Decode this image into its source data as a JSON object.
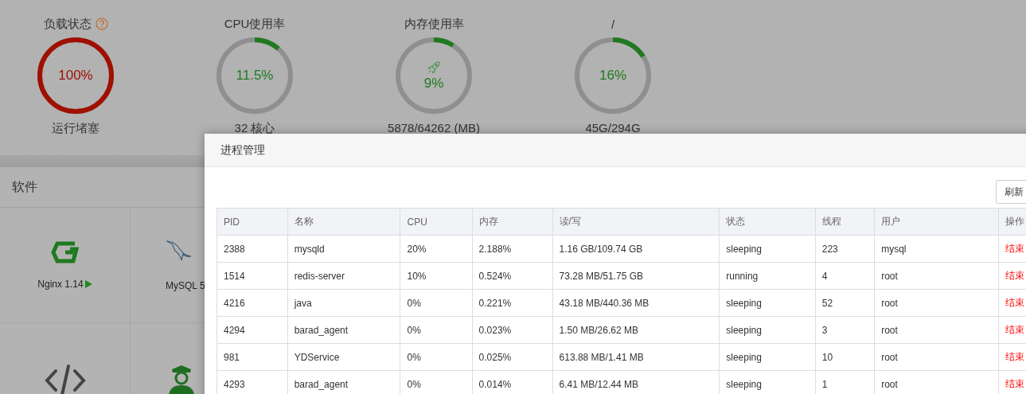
{
  "gauges": [
    {
      "title": "负载状态",
      "help": true,
      "value": "100%",
      "level": 1,
      "color": "#a01000",
      "caption": "运行堵塞"
    },
    {
      "title": "CPU使用率",
      "help": false,
      "value": "11.5%",
      "level": 0.115,
      "color": "#1f7a1f",
      "caption": "32 核心"
    },
    {
      "title": "内存使用率",
      "help": false,
      "value": "9%",
      "level": 0.09,
      "color": "#1f7a1f",
      "caption": "5878/64262 (MB)"
    },
    {
      "title": "/",
      "help": false,
      "value": "16%",
      "level": 0.16,
      "color": "#1f7a1f",
      "caption": "45G/294G"
    }
  ],
  "software": {
    "title": "软件",
    "items": [
      {
        "kind": "nginx",
        "name": "Nginx 1.14",
        "running": true
      },
      {
        "kind": "mysql",
        "name": "MySQL 5"
      },
      {
        "kind": "code"
      },
      {
        "kind": "person"
      }
    ]
  },
  "dialog": {
    "title": "进程管理",
    "refresh_button": "刷新",
    "table": {
      "columns": [
        "PID",
        "名称",
        "CPU",
        "内存",
        "读/写",
        "状态",
        "线程",
        "用户",
        "操作"
      ],
      "rows": [
        [
          "2388",
          "mysqld",
          "20%",
          "2.188%",
          "1.16 GB/109.74 GB",
          "sleeping",
          "223",
          "mysql",
          "结束"
        ],
        [
          "1514",
          "redis-server",
          "10%",
          "0.524%",
          "73.28 MB/51.75 GB",
          "running",
          "4",
          "root",
          "结束"
        ],
        [
          "4216",
          "java",
          "0%",
          "0.221%",
          "43.18 MB/440.36 MB",
          "sleeping",
          "52",
          "root",
          "结束"
        ],
        [
          "4294",
          "barad_agent",
          "0%",
          "0.023%",
          "1.50 MB/26.62 MB",
          "sleeping",
          "3",
          "root",
          "结束"
        ],
        [
          "981",
          "YDService",
          "0%",
          "0.025%",
          "613.88 MB/1.41 MB",
          "sleeping",
          "10",
          "root",
          "结束"
        ],
        [
          "4293",
          "barad_agent",
          "0%",
          "0.014%",
          "6.41 MB/12.44 MB",
          "sleeping",
          "1",
          "root",
          "结束"
        ]
      ]
    }
  }
}
